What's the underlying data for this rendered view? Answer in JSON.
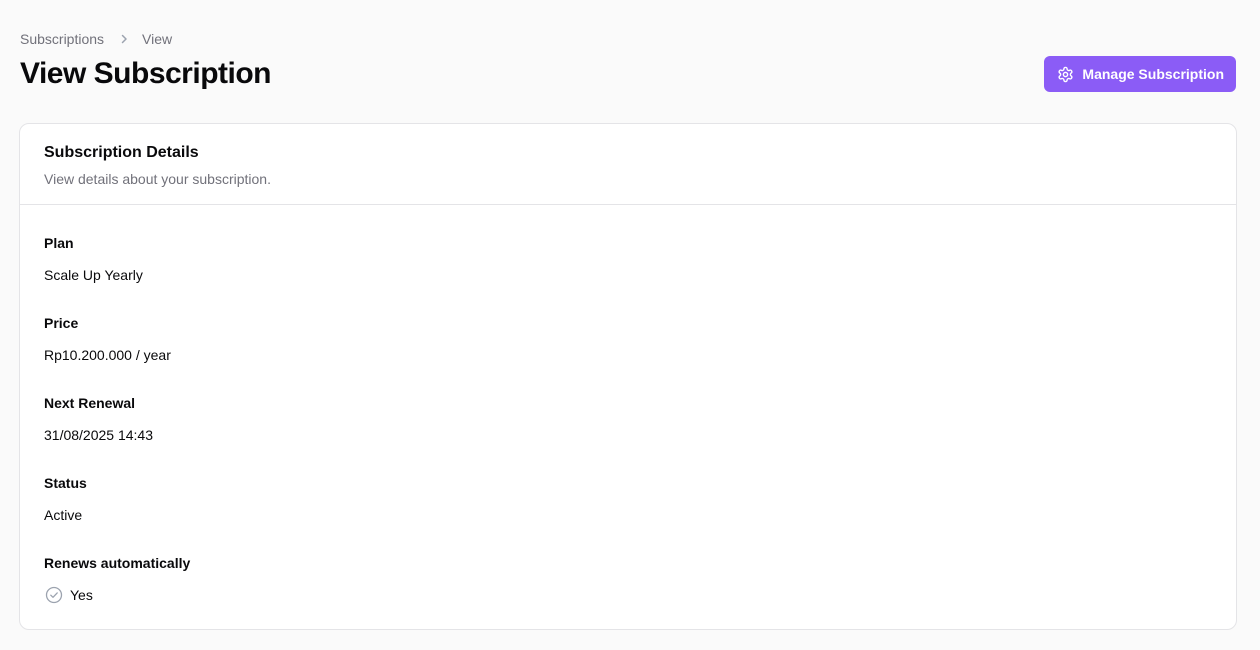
{
  "breadcrumb": {
    "items": [
      "Subscriptions",
      "View"
    ]
  },
  "page": {
    "title": "View Subscription"
  },
  "actions": {
    "manage_label": "Manage Subscription"
  },
  "card": {
    "title": "Subscription Details",
    "description": "View details about your subscription.",
    "fields": {
      "plan": {
        "label": "Plan",
        "value": "Scale Up Yearly"
      },
      "price": {
        "label": "Price",
        "value": "Rp10.200.000 / year"
      },
      "next_renewal": {
        "label": "Next Renewal",
        "value": "31/08/2025 14:43"
      },
      "status": {
        "label": "Status",
        "value": "Active"
      },
      "renews_automatically": {
        "label": "Renews automatically",
        "value": "Yes",
        "icon": "check-circle-icon"
      }
    }
  },
  "colors": {
    "accent": "#8b5cf6",
    "background": "#fafafa",
    "muted_text": "#71717a",
    "border": "#e4e4e7"
  }
}
